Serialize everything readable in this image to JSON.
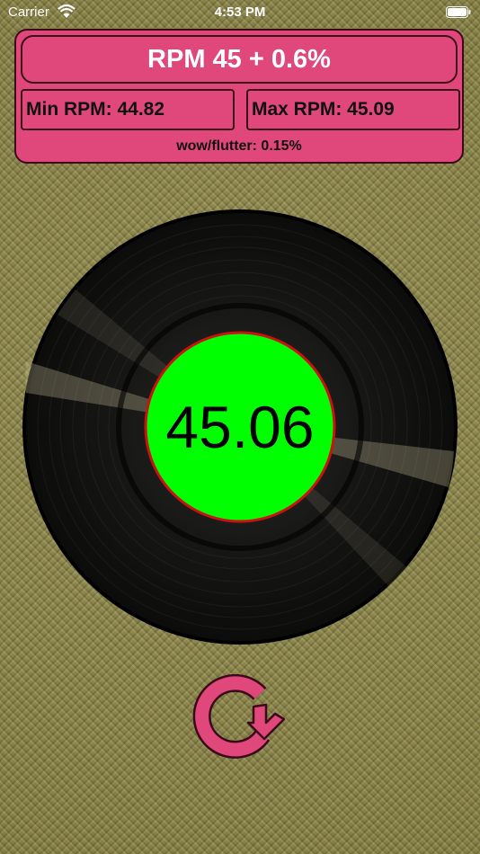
{
  "status_bar": {
    "carrier": "Carrier",
    "time": "4:53 PM",
    "wifi_icon": "wifi-icon",
    "battery_icon": "battery-icon"
  },
  "panel": {
    "rpm_header": "RPM 45 + 0.6%",
    "min_rpm": "Min RPM: 44.82",
    "max_rpm": "Max RPM: 45.09",
    "wow_flutter": "wow/flutter: 0.15%"
  },
  "record": {
    "current_rpm": "45.06",
    "label_color": "#00ff00",
    "label_border_color": "#cc1111"
  },
  "refresh_button": {
    "icon": "refresh-icon",
    "color": "#e0487c"
  },
  "colors": {
    "panel_bg": "#e0487c",
    "background": "#8a8448"
  }
}
